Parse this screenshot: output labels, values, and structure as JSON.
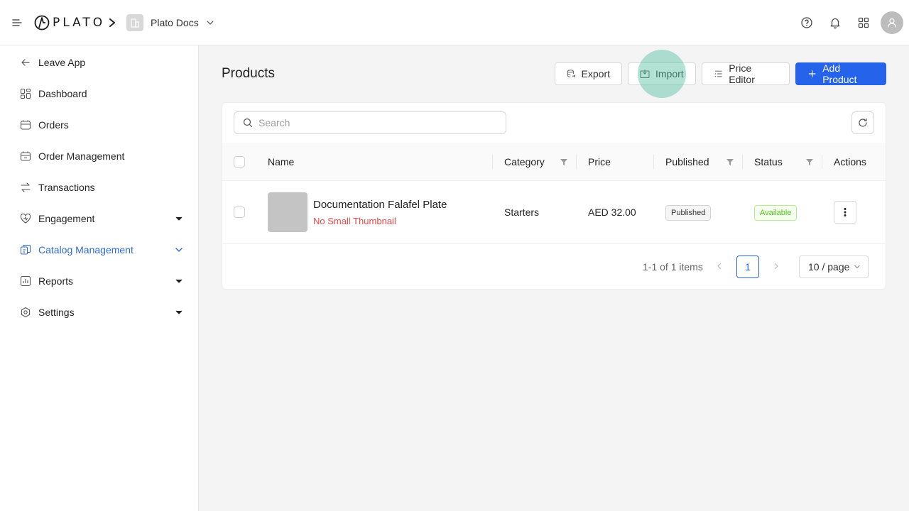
{
  "header": {
    "logo_text": "PLATO",
    "workspace_name": "Plato Docs",
    "icons": [
      "menu-icon",
      "help-icon",
      "bell-icon",
      "apps-grid-icon",
      "user-icon"
    ]
  },
  "sidebar": {
    "items": [
      {
        "label": "Leave App",
        "icon": "arrow-left-icon"
      },
      {
        "label": "Dashboard",
        "icon": "dashboard-icon"
      },
      {
        "label": "Orders",
        "icon": "orders-icon"
      },
      {
        "label": "Order Management",
        "icon": "order-management-icon"
      },
      {
        "label": "Transactions",
        "icon": "transactions-icon"
      },
      {
        "label": "Engagement",
        "icon": "engagement-icon",
        "expandable": true
      },
      {
        "label": "Catalog Management",
        "icon": "catalog-icon",
        "expandable": true,
        "active": true
      },
      {
        "label": "Reports",
        "icon": "reports-icon",
        "expandable": true
      },
      {
        "label": "Settings",
        "icon": "settings-icon",
        "expandable": true
      }
    ],
    "active_color": "#2e6bd9"
  },
  "page": {
    "title": "Products",
    "buttons": {
      "export": "Export",
      "import": "Import",
      "price_editor": "Price Editor",
      "add_product": "Add Product"
    },
    "accent_color": "#2563eb"
  },
  "table": {
    "search_placeholder": "Search",
    "columns": {
      "name": "Name",
      "category": "Category",
      "price": "Price",
      "published": "Published",
      "status": "Status",
      "actions": "Actions"
    },
    "rows": [
      {
        "name": "Documentation Falafel Plate",
        "warning": "No Small Thumbnail",
        "category": "Starters",
        "price": "AED 32.00",
        "published": "Published",
        "status": "Available"
      }
    ],
    "pagination": {
      "info": "1-1 of 1 items",
      "current_page": "1",
      "page_size": "10 / page"
    }
  }
}
